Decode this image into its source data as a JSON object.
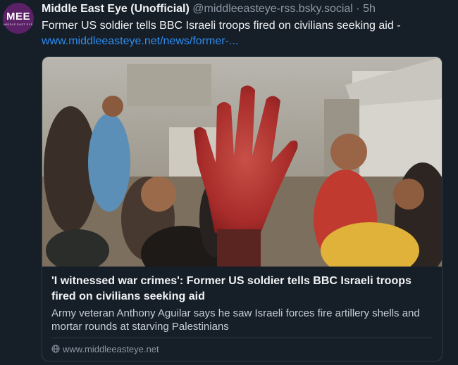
{
  "post": {
    "author_name": "Middle East Eye (Unofficial)",
    "handle": "@middleeasteye-rss.bsky.social",
    "separator": "·",
    "time_ago": "5h",
    "text": "Former US soldier tells BBC Israeli troops fired on civilians seeking aid -",
    "link_text": "www.middleeasteye.net/news/former-..."
  },
  "avatar": {
    "logo_text": "MEE",
    "logo_subtext": "MIDDLE EAST EYE",
    "brand_color": "#5a2166"
  },
  "card": {
    "title": "'I witnessed war crimes': Former US soldier tells BBC Israeli troops fired on civilians seeking aid",
    "description": "Army veteran Anthony Aguilar says he saw Israeli forces fire artillery shells and mortar rounds at starving Palestinians",
    "source": "www.middleeasteye.net",
    "source_icon": "globe-icon"
  },
  "colors": {
    "background": "#161e27",
    "link": "#2e8df0",
    "muted": "#8d99a6",
    "border": "#2e3a47"
  }
}
